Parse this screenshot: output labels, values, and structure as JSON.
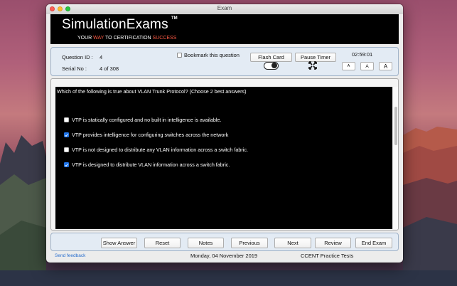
{
  "window": {
    "title": "Exam"
  },
  "banner": {
    "brand": "SimulationExams",
    "trademark": "TM",
    "tagline_part1": "YOUR ",
    "tagline_part2": "WAY",
    "tagline_part3": " TO CERTIFICATION ",
    "tagline_part4": "SUCCESS"
  },
  "info": {
    "question_id_label": "Question ID :",
    "question_id_value": "4",
    "serial_label": "Serial No :",
    "serial_value": "4 of 308",
    "bookmark_label": "Bookmark this question",
    "flash_card_label": "Flash Card",
    "pause_timer_label": "Pause Timer",
    "timer": "02:59:01",
    "font_small": "A",
    "font_medium": "A",
    "font_large": "A"
  },
  "question": {
    "text": "Which of the following is true about VLAN Trunk Protocol? (Choose 2 best answers)",
    "options": [
      {
        "text": "VTP is statically configured and no built in intelligence is available.",
        "checked": false
      },
      {
        "text": "VTP provides intelligence for configuring switches across the network",
        "checked": true
      },
      {
        "text": "VTP is not designed to distribute any VLAN information across a switch fabric.",
        "checked": false
      },
      {
        "text": "VTP is designed to distribute VLAN information across a switch fabric.",
        "checked": true
      }
    ]
  },
  "buttons": {
    "show_answer": "Show Answer",
    "reset": "Reset",
    "notes": "Notes",
    "previous": "Previous",
    "next": "Next",
    "review": "Review",
    "end_exam": "End Exam"
  },
  "footer": {
    "feedback": "Send feedback",
    "date": "Monday, 04 November 2019",
    "product": "CCENT Practice Tests"
  },
  "colors": {
    "accent_red": "#ff5a44",
    "checkbox_blue": "#1f73e6",
    "panel_bg": "#e3ebf4",
    "link_blue": "#2a6fce"
  }
}
